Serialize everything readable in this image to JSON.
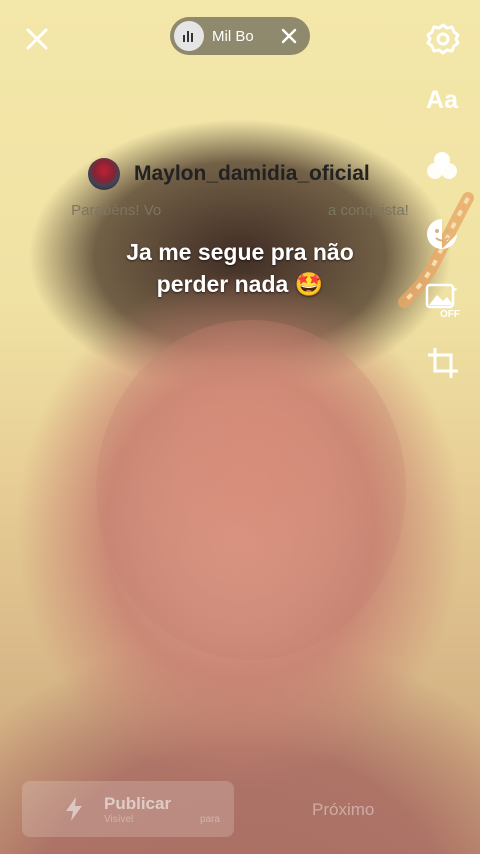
{
  "top_bar": {
    "music_title": "Mil Bo",
    "icons": [
      "close-icon",
      "music-icon",
      "clear-icon",
      "settings-icon"
    ]
  },
  "right_toolbar": {
    "text_label": "Aa",
    "icons": [
      "text-icon",
      "filters-icon",
      "stickers-icon",
      "auto-enhance-off-icon",
      "crop-icon"
    ],
    "enhance_state": "OFF"
  },
  "overlay": {
    "username": "Maylon_damidia_oficial",
    "congrats": "Parabéns! Vo                                        a conquista!",
    "caption_line1": "Ja me segue pra não",
    "caption_line2": "perder nada 🤩"
  },
  "bottom": {
    "publish_label": "Publicar",
    "publish_sub": "Visível                        para",
    "next_label": "Próximo"
  },
  "colors": {
    "accent": "#ffffff",
    "pill_bg": "#3c3c3c"
  }
}
